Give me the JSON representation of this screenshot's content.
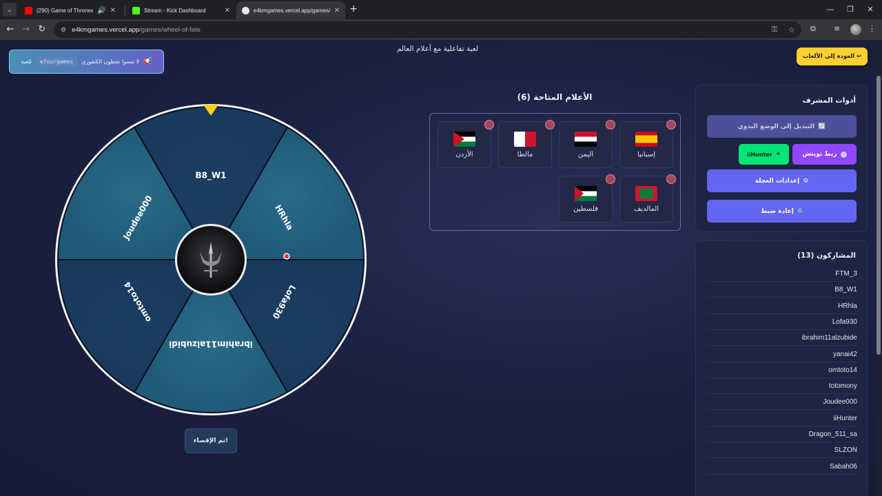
{
  "browser": {
    "tabs": [
      {
        "title": "(290) Game of Thrones The",
        "favicon_color": "#ff0000",
        "audio": true
      },
      {
        "title": "Stream - Kick Dashboard",
        "favicon_color": "#53fc18"
      },
      {
        "title": "e4kmgames.vercel.app/games/",
        "favicon_color": "#e8e8e8",
        "active": true
      }
    ],
    "url_host": "e4kmgames.vercel.app",
    "url_path": "/games/wheel-of-fate"
  },
  "page": {
    "subtitle": "لعبة تفاعلية مع أعلام العالم",
    "banner": {
      "text_before": "لا تنسوا تحطون الكتفوري",
      "chip": "efourgames",
      "text_after": "للعبة"
    },
    "back_button": "↩ العودة إلى الألعاب"
  },
  "wheel": {
    "segments": [
      "B8_W1",
      "HRhla",
      "Lofa930",
      "ibrahim11alzubidi",
      "omtoto14",
      "Joudee000"
    ],
    "stop_button": "تم الإقصاء!"
  },
  "flags": {
    "title": "الأعلام المتاحة (6)",
    "items": [
      {
        "name": "إسبانيا",
        "code": "es"
      },
      {
        "name": "اليمن",
        "code": "ye"
      },
      {
        "name": "مالطا",
        "code": "mt"
      },
      {
        "name": "الأردن",
        "code": "jo"
      },
      {
        "name": "المالديف",
        "code": "mv"
      },
      {
        "name": "فلسطين",
        "code": "ps"
      }
    ]
  },
  "admin": {
    "title": "أدوات المشرف",
    "manual_mode": "التبديل إلى الوضع اليدوي",
    "twitch": "ربط تويتش",
    "user_chip": "iiHunter",
    "wheel_settings": "إعدادات العجلة",
    "reset": "إعادة ضبط"
  },
  "participants": {
    "title": "المشاركون (13)",
    "names": [
      "FTM_3",
      "B8_W1",
      "HRhla",
      "Lofa930",
      "ibrahim11alzubide",
      "yanai42",
      "omtoto14",
      "totomony",
      "Joudee000",
      "iiHunter",
      "Dragon_511_sa",
      "SLZON",
      "Sabah06"
    ]
  },
  "colors": {
    "accent": "#6366f1",
    "back_button": "#ffcf2e",
    "twitch": "#9146ff",
    "chip_green": "#00e676"
  }
}
